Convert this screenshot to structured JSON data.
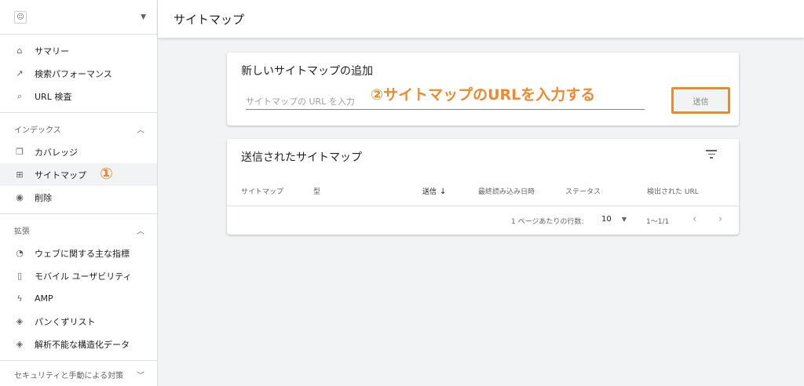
{
  "header": {
    "title": "サイトマップ"
  },
  "sidebar": {
    "primary": [
      {
        "label": "サマリー",
        "icon": "home-icon"
      },
      {
        "label": "検索パフォーマンス",
        "icon": "trend-icon"
      },
      {
        "label": "URL 検査",
        "icon": "search-icon"
      }
    ],
    "index_section": {
      "title": "インデックス"
    },
    "index_items": [
      {
        "label": "カバレッジ",
        "icon": "copy-icon"
      },
      {
        "label": "サイトマップ",
        "icon": "sitemap-icon"
      },
      {
        "label": "削除",
        "icon": "eye-off-icon"
      }
    ],
    "ext_section": {
      "title": "拡張"
    },
    "ext_items": [
      {
        "label": "ウェブに関する主な指標",
        "icon": "gauge-icon"
      },
      {
        "label": "モバイル ユーザビリティ",
        "icon": "phone-icon"
      },
      {
        "label": "AMP",
        "icon": "bolt-icon"
      },
      {
        "label": "パンくずリスト",
        "icon": "layers-icon"
      },
      {
        "label": "解析不能な構造化データ",
        "icon": "layers-icon"
      }
    ],
    "security_section": {
      "title": "セキュリティと手動による対策"
    },
    "marker": "①"
  },
  "add_card": {
    "title": "新しいサイトマップの追加",
    "input_placeholder": "サイトマップの URL を入力",
    "submit_label": "送信",
    "annotation": "②サイトマップのURLを入力する"
  },
  "list_card": {
    "title": "送信されたサイトマップ",
    "columns": [
      "サイトマップ",
      "型",
      "送信",
      "最終読み込み日時",
      "ステータス",
      "検出された URL"
    ],
    "rows_per_page_label": "1 ページあたりの行数:",
    "rows_per_page_value": "10",
    "range": "1〜1/1"
  }
}
